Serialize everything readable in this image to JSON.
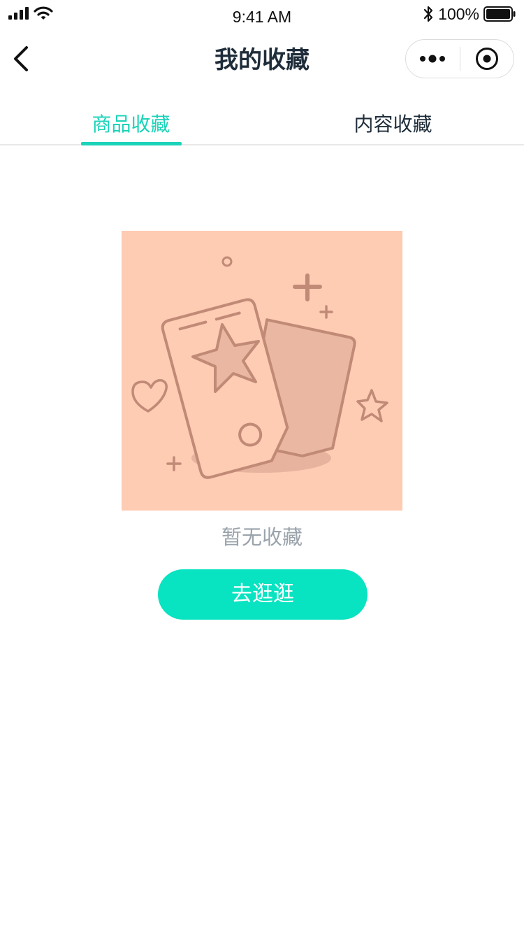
{
  "status_bar": {
    "time": "9:41 AM",
    "battery_percent": "100%"
  },
  "nav": {
    "title": "我的收藏"
  },
  "tabs": [
    {
      "label": "商品收藏",
      "active": true
    },
    {
      "label": "内容收藏",
      "active": false
    }
  ],
  "empty_state": {
    "message": "暂无收藏",
    "button_label": "去逛逛"
  },
  "colors": {
    "accent": "#1bd3b8",
    "button": "#08e3c1",
    "illustration_bg": "#fecbb3",
    "illustration_stroke": "#c08a76",
    "title": "#1f2d3a",
    "muted_text": "#9aa3ab"
  },
  "icons": {
    "back": "chevron-left-icon",
    "more": "more-dots-icon",
    "close": "target-circle-icon",
    "signal": "cellular-signal-icon",
    "wifi": "wifi-icon",
    "bluetooth": "bluetooth-icon",
    "battery": "battery-icon"
  }
}
